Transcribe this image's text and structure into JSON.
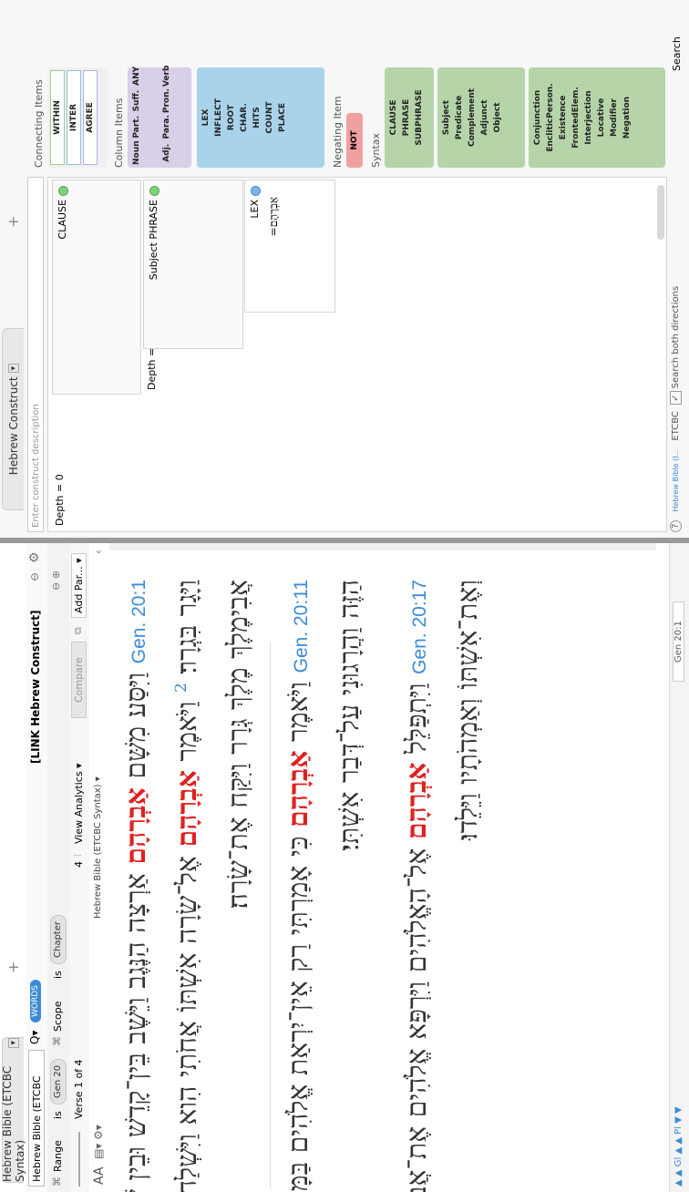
{
  "left": {
    "tab_label": "Hebrew Bible (ETCBC Syntax)",
    "version": "Hebrew Bible (ETCBC Synt...",
    "search_chip": "WORDS",
    "search_query": "[LINK Hebrew Construct]",
    "filter": {
      "range_label": "Range",
      "is": "is",
      "range_value": "Gen 20",
      "scope_label": "Scope",
      "scope_value": "Chapter"
    },
    "toolbar": {
      "verse_of": "Verse 1 of 4",
      "hits": "4",
      "view_analytics": "View Analytics ▾",
      "compare": "Compare",
      "add_parallel": "Add Par... ▾"
    },
    "text_header": {
      "font_button": "AA",
      "title": "Hebrew Bible (ETCBC Syntax) ▾"
    },
    "status": {
      "location": "Gen 20:1"
    }
  },
  "verses": [
    {
      "ref": "Gen. 20:1",
      "pre": "וַיִּסַּע מִשָּׁם ",
      "hl": "אַבְרָהָם",
      "post": " אַרְצָה הַנֶּגֶב וַיֵּשֶׁב בֵּין־קָדֵשׁ וּבֵין שׁוּר",
      "line2": "וַיָּגָר בִּגְרָר׃"
    },
    {
      "num": "2",
      "pre": "וַיֹּאמֶר ",
      "hl": "אַבְרָהָם",
      "post": " אֶל־שָׂרָה אִשְׁתּוֹ אֲחֹתִי הִוא וַיִּשְׁלַח",
      "line2": "אֲבִימֶלֶךְ מֶלֶךְ גְּרָר וַיִּקַּח אֶת־שָׂרָה׃"
    },
    {
      "ref": "Gen. 20:11",
      "pre": "וַיֹּאמֶר ",
      "hl": "אַבְרָהָם",
      "post": " כִּי אָמַרְתִּי רַק אֵין־יִרְאַת אֱלֹהִים בַּמָּקוֹם",
      "line2": "הַזֶּה וַהֲרָגוּנִי עַל־דְּבַר אִשְׁתִּי׃"
    },
    {
      "ref": "Gen. 20:17",
      "pre": "וַיִּתְפַּלֵּל ",
      "hl": "אַבְרָהָם",
      "post": " אֶל־הָאֱלֹהִים וַיִּרְפָּא אֱלֹהִים אֶת־אֲבִימֶלֶךְ",
      "line2": "וְאֶת־אִשְׁתּוֹ וְאַמְהֹתָיו וַיֵּלֵדוּ׃"
    }
  ],
  "right": {
    "tab_label": "Hebrew Construct",
    "description_placeholder": "Enter construct description",
    "canvas": {
      "depth_outer": "Depth = 0",
      "clause": "CLAUSE",
      "depth_inner": "Depth = 0",
      "phrase": "Subject PHRASE",
      "lex": "LEX",
      "lex_value": "=אַבְרָהָם"
    },
    "status": {
      "bible": "Hebrew Bible (I...",
      "db": "ETCBC",
      "search_both": "Search both directions"
    }
  },
  "palette": {
    "connecting_header": "Connecting Items",
    "connecting": [
      "WITHIN",
      "INTER",
      "AGREE"
    ],
    "column_header": "Column Items",
    "column": [
      "Noun",
      "Part.",
      "Suff.",
      "ANY",
      "Adj.",
      "Para.",
      "Pron.",
      "Verb"
    ],
    "lex": [
      "LEX",
      "INFLECT",
      "ROOT",
      "CHAR.",
      "HITS",
      "COUNT",
      "PLACE"
    ],
    "negating_header": "Negating Item",
    "not": "NOT",
    "syntax_header": "Syntax",
    "syntax_a": [
      "CLAUSE",
      "PHRASE",
      "SUBPHRASE"
    ],
    "syntax_b": [
      "Subject",
      "Predicate",
      "Complement",
      "Adjunct",
      "Object"
    ],
    "syntax_c": [
      "Conjunction",
      "EncliticPerson.",
      "Existence",
      "FrontedElem.",
      "Interjection",
      "Locative",
      "Modifier",
      "Negation"
    ],
    "search": "Search"
  }
}
